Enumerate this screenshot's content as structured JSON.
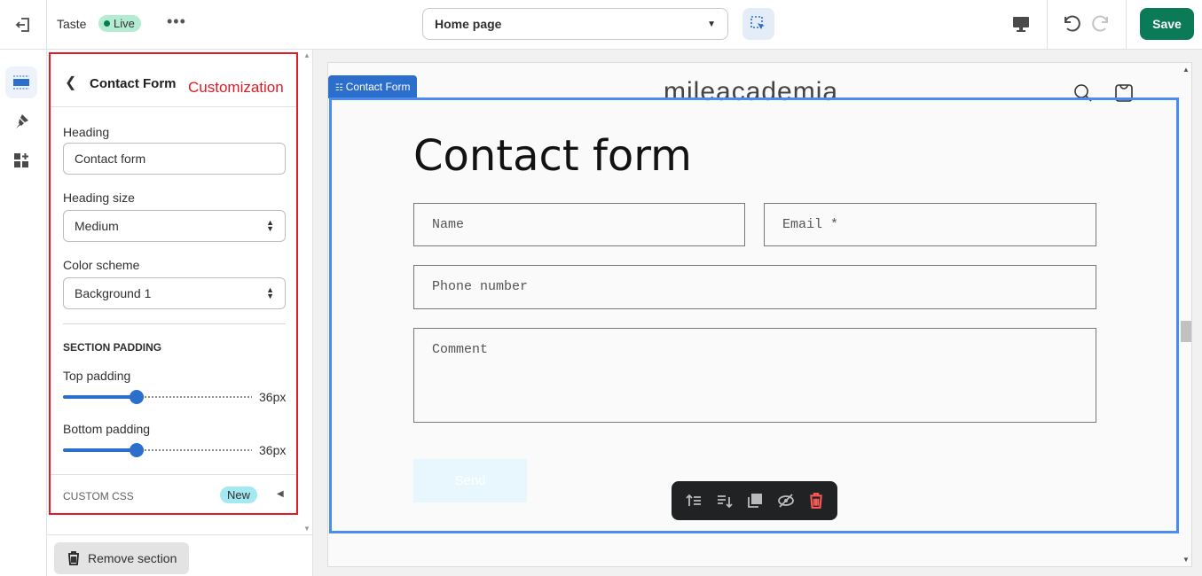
{
  "topbar": {
    "theme_name": "Taste",
    "status": "Live",
    "page_select": "Home page",
    "save_label": "Save"
  },
  "sidebar": {
    "title": "Contact Form",
    "annotation": "Customization",
    "heading_label": "Heading",
    "heading_value": "Contact form",
    "heading_size_label": "Heading size",
    "heading_size_value": "Medium",
    "color_scheme_label": "Color scheme",
    "color_scheme_value": "Background 1",
    "section_padding": "SECTION PADDING",
    "top_padding_label": "Top padding",
    "top_padding_value": "36px",
    "top_padding_fraction": 0.36,
    "bottom_padding_label": "Bottom padding",
    "bottom_padding_value": "36px",
    "bottom_padding_fraction": 0.36,
    "custom_css": "CUSTOM CSS",
    "new_badge": "New",
    "remove_label": "Remove section"
  },
  "preview": {
    "logo": "mileacademia",
    "section_tag": "Contact Form",
    "heading": "Contact form",
    "name_placeholder": "Name",
    "email_placeholder": "Email *",
    "phone_placeholder": "Phone number",
    "comment_placeholder": "Comment",
    "send_label": "Send"
  },
  "colors": {
    "accent": "#2c6ecb",
    "save": "#0b7a56",
    "annotation": "#e01b24",
    "selection": "#4a8df0",
    "delete": "#ff5a5a"
  }
}
